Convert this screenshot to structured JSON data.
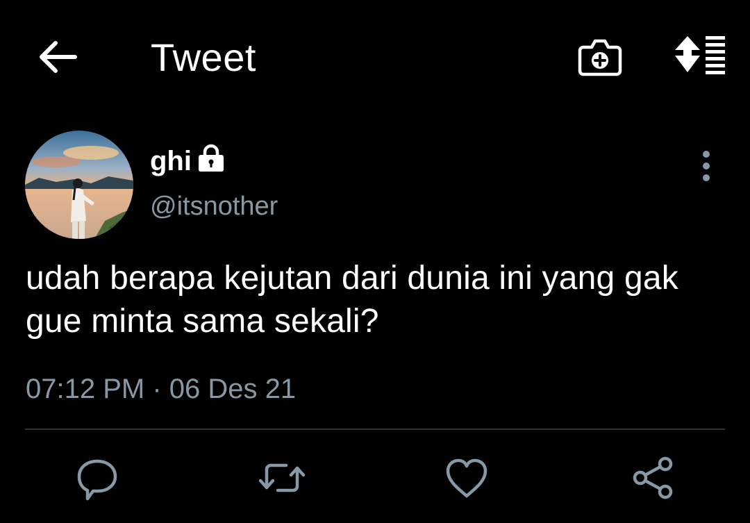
{
  "header": {
    "title": "Tweet",
    "back_icon": "arrow-left-icon",
    "camera_icon": "camera-plus-icon",
    "sort_icon": "sort-list-icon"
  },
  "tweet": {
    "author": {
      "display_name": "ghi",
      "handle": "@itsnother",
      "protected_icon": "lock-icon",
      "avatar": "avatar-photo-sunset-lake"
    },
    "text": "udah berapa kejutan dari dunia ini yang gak gue minta sama sekali?",
    "time": "07:12 PM",
    "separator": "·",
    "date": "06 Des 21",
    "more_icon": "more-vertical-icon"
  },
  "actions": [
    {
      "name": "reply",
      "icon": "reply-icon"
    },
    {
      "name": "retweet",
      "icon": "retweet-icon"
    },
    {
      "name": "like",
      "icon": "heart-icon"
    },
    {
      "name": "share",
      "icon": "share-icon"
    }
  ],
  "colors": {
    "background": "#000000",
    "text_primary": "#ffffff",
    "text_secondary": "#8899a6",
    "divider": "#2f3336"
  }
}
